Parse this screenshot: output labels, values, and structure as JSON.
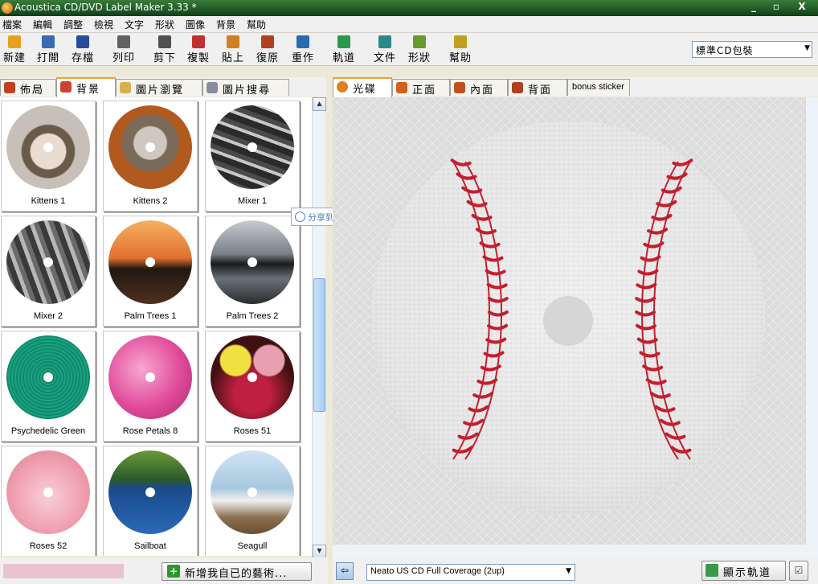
{
  "window": {
    "title": "Acoustica CD/DVD Label Maker 3.33 *",
    "min": "_",
    "max": "▫",
    "close": "X"
  },
  "menu": [
    "檔案",
    "編輯",
    "調整",
    "檢視",
    "文字",
    "形狀",
    "圖像",
    "背景",
    "幫助"
  ],
  "toolbar": {
    "items": [
      {
        "label": "新建",
        "icon": "new-icon",
        "color": "#e8a020"
      },
      {
        "label": "打開",
        "icon": "open-icon",
        "color": "#3a6ab0"
      },
      {
        "label": "存檔",
        "icon": "save-icon",
        "color": "#2a4a9a"
      },
      {
        "label": "列印",
        "icon": "print-icon",
        "color": "#606060"
      },
      {
        "label": "剪下",
        "icon": "cut-icon",
        "color": "#505050"
      },
      {
        "label": "複製",
        "icon": "copy-icon",
        "color": "#c03030"
      },
      {
        "label": "貼上",
        "icon": "paste-icon",
        "color": "#d08020"
      },
      {
        "label": "復原",
        "icon": "undo-icon",
        "color": "#b04020"
      },
      {
        "label": "重作",
        "icon": "redo-icon",
        "color": "#2a6ab0"
      },
      {
        "label": "軌道",
        "icon": "tracks-icon",
        "color": "#2a9a4a"
      },
      {
        "label": "文件",
        "icon": "text-icon",
        "color": "#2a8a8a"
      },
      {
        "label": "形狀",
        "icon": "shape-icon",
        "color": "#6a9a2a"
      },
      {
        "label": "幫助",
        "icon": "help-icon",
        "color": "#c0a020"
      }
    ],
    "package_select": "標準CD包裝"
  },
  "left_tabs": [
    {
      "label": "佈局",
      "icon": "layout-icon",
      "active": false
    },
    {
      "label": "背景",
      "icon": "background-icon",
      "active": true
    },
    {
      "label": "圖片瀏覽",
      "icon": "image-browse-icon",
      "active": false
    },
    {
      "label": "圖片搜尋",
      "icon": "image-search-icon",
      "active": false
    }
  ],
  "gallery": [
    {
      "name": "Kittens  1",
      "bg": "radial-gradient(circle at 50% 55%, #e8dcd0 0 28%, #6a5a4a 30% 42%, #c8c0b8 44%)"
    },
    {
      "name": "Kittens  2",
      "bg": "radial-gradient(circle at 50% 45%, #d0c8c0 0 26%, #7a6a5a 28% 45%, #b05a20 47%)"
    },
    {
      "name": "Mixer 1",
      "bg": "repeating-linear-gradient(20deg, #2a2a2a 0 8px, #c8c8c8 8px 12px, #4a4a4a 12px 18px)"
    },
    {
      "name": "Mixer 2",
      "bg": "repeating-linear-gradient(70deg, #3a3a3a 0 7px, #b8b8b8 7px 12px, #6a6a6a 12px 18px)"
    },
    {
      "name": "Palm Trees 1",
      "bg": "linear-gradient(#f8b060 0%, #e07030 45%, #201810 58%, #503020 100%)"
    },
    {
      "name": "Palm Trees 2",
      "bg": "linear-gradient(#c8ccd0 0%, #7a8088 40%, #1a1a1a 52%, #6a7078 70%, #2a2a2a 100%)"
    },
    {
      "name": "Psychedelic Green",
      "bg": "repeating-radial-gradient(circle, #1aa080 0 2px, #0e8a6c 2px 4px)"
    },
    {
      "name": "Rose Petals 8",
      "bg": "radial-gradient(circle at 40% 40%, #f8a8d0, #e04a9a 55%, #a82a6a)"
    },
    {
      "name": "Roses 51",
      "bg": "radial-gradient(circle at 30% 30%, #f0e040 0 18%, transparent 20%), radial-gradient(circle at 70% 30%, #e8a0b0 0 18%, transparent 20%), radial-gradient(circle at 50% 70%, #c02040 0 25%, #401010 60%)"
    },
    {
      "name": "Roses 52",
      "bg": "radial-gradient(circle at 50% 55%, #f8d0d8, #f0a0b0 55%, #d88090)"
    },
    {
      "name": "Sailboat",
      "bg": "linear-gradient(#6a9a3a 0%, #2a5a2a 35%, #1a4a8a 45%, #2a6ab8 100%)"
    },
    {
      "name": "Seagull",
      "bg": "linear-gradient(#d0e4f4 0%, #a8c8e0 45%, #f0f0f0 60%, #8a7050 80%, #6a5030 100%)"
    }
  ],
  "right_tabs": [
    {
      "label": "光碟",
      "icon": "disc-icon",
      "active": true
    },
    {
      "label": "正面",
      "icon": "front-icon",
      "active": false
    },
    {
      "label": "內面",
      "icon": "inside-icon",
      "active": false
    },
    {
      "label": "背面",
      "icon": "back-icon",
      "active": false
    },
    {
      "label": "bonus sticker",
      "icon": "",
      "active": false
    }
  ],
  "share_popup": "分享到微博",
  "bottom": {
    "add_art": "新增我自已的藝術...",
    "layout_select": "Neato US CD Full Coverage (2up)",
    "show_tracks": "顯示軌道"
  }
}
